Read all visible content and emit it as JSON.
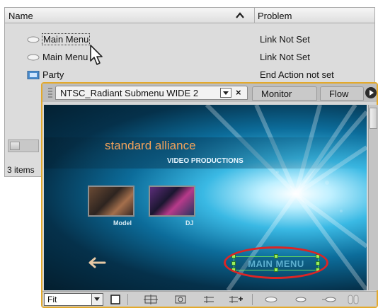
{
  "links_panel": {
    "columns": {
      "name": "Name",
      "problem": "Problem"
    },
    "rows": [
      {
        "icon": "button-icon",
        "name": "Main Menu",
        "problem": "Link Not Set"
      },
      {
        "icon": "button-icon",
        "name": "Main Menu",
        "problem": "Link Not Set"
      },
      {
        "icon": "timeline-icon",
        "name": "Party",
        "problem": "End Action not set"
      }
    ],
    "items_count": "3 items"
  },
  "menu_viewer": {
    "tabs": {
      "active": "NTSC_Radiant Submenu WIDE 2",
      "close": "×",
      "monitor": "Monitor",
      "flow": "Flow"
    },
    "canvas": {
      "brand_title": "standard alliance",
      "brand_subtitle": "VIDEO PRODUCTIONS",
      "thumb_model_label": "Model",
      "thumb_dj_label": "DJ",
      "main_menu_button": "MAIN MENU"
    },
    "toolbar": {
      "zoom": "Fit"
    }
  },
  "colors": {
    "panel_highlight": "#e3a92c",
    "brand_orange": "#f2a25a",
    "annotation_red": "#dc2525",
    "selection_green": "#63d85b"
  }
}
